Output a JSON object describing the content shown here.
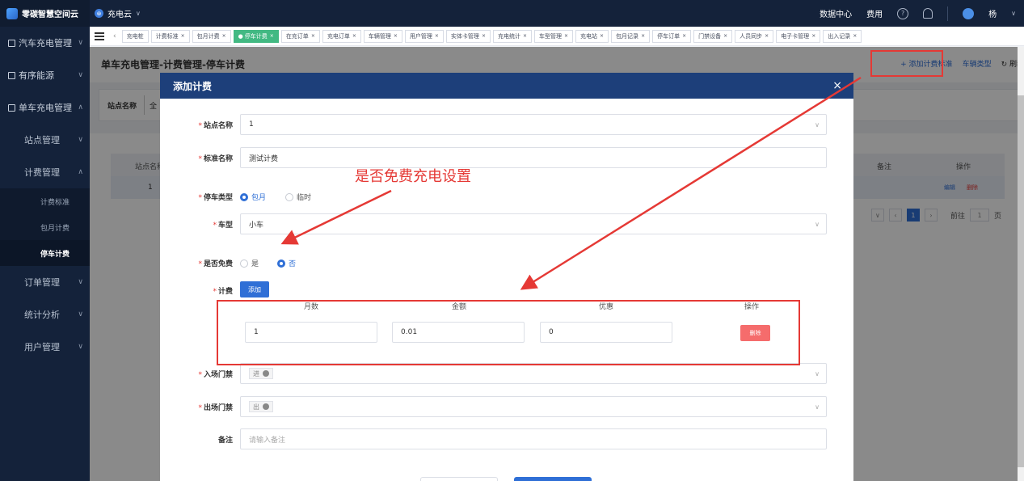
{
  "topbar": {
    "brand": "零碳智慧空间云",
    "app": "充电云",
    "links": [
      "数据中心",
      "费用"
    ],
    "user": "杨"
  },
  "sidebar": {
    "items": [
      {
        "label": "汽车充电管理"
      },
      {
        "label": "有序能源"
      },
      {
        "label": "单车充电管理"
      },
      {
        "label": "站点管理"
      },
      {
        "label": "计费管理"
      },
      {
        "label": "计费标准"
      },
      {
        "label": "包月计费"
      },
      {
        "label": "停车计费"
      },
      {
        "label": "订单管理"
      },
      {
        "label": "统计分析"
      },
      {
        "label": "用户管理"
      }
    ]
  },
  "tabs": [
    "充电桩",
    "计费标准",
    "包月计费",
    "停车计费",
    "在充订单",
    "充电订单",
    "车辆管理",
    "用户管理",
    "实体卡管理",
    "充电统计",
    "车型管理",
    "充电站",
    "包月记录",
    "停车订单",
    "门禁设备",
    "人员同步",
    "电子卡管理",
    "出入记录"
  ],
  "page": {
    "title": "单车充电管理-计费管理-停车计费",
    "actions": {
      "add": "+ 添加计费标准",
      "vehicle_type": "车辆类型",
      "refresh": "刷新"
    },
    "filter_label": "站点名称",
    "filter_value": "全",
    "table_headers": {
      "col1": "站点名称",
      "remark": "备注",
      "op": "操作"
    },
    "table_row": {
      "col1": "1",
      "edit": "编辑",
      "delete": "删除"
    },
    "pager": {
      "page": "1",
      "goto": "前往",
      "page_num": "1",
      "page_unit": "页"
    }
  },
  "modal": {
    "title": "添加计费",
    "close": "×",
    "fields": {
      "station": {
        "label": "站点名称",
        "value": "1"
      },
      "standard": {
        "label": "标准名称",
        "value": "测试计费"
      },
      "park_type": {
        "label": "停车类型",
        "opt1": "包月",
        "opt2": "临时"
      },
      "car_type": {
        "label": "车型",
        "value": "小车"
      },
      "free": {
        "label": "是否免费",
        "opt_yes": "是",
        "opt_no": "否"
      },
      "fee": {
        "label": "计费",
        "add": "添加"
      },
      "entry": {
        "label": "入场门禁",
        "chip": "进"
      },
      "exit": {
        "label": "出场门禁",
        "chip": "出"
      },
      "remark": {
        "label": "备注",
        "placeholder": "请输入备注"
      }
    },
    "price_table": {
      "headers": [
        "月数",
        "金额",
        "优惠",
        "操作"
      ],
      "row": {
        "months": "1",
        "amount": "0.01",
        "discount": "0",
        "delete": "删除"
      }
    }
  },
  "annotation": {
    "text": "是否免费充电设置",
    "color": "#e53935"
  }
}
